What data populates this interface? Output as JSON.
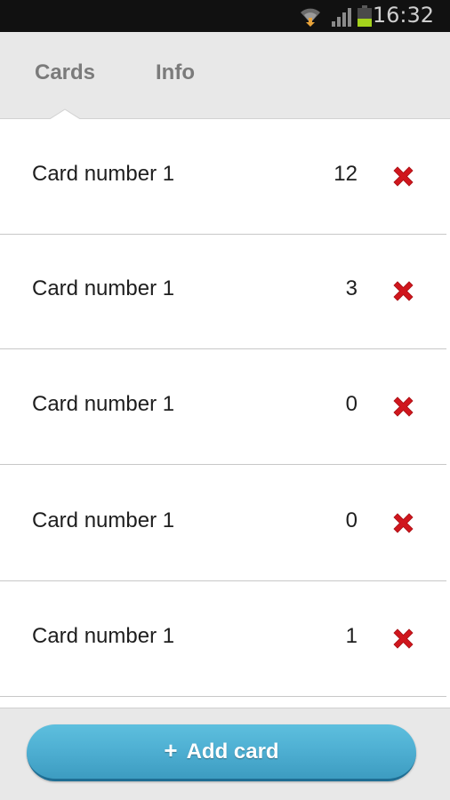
{
  "status_bar": {
    "time": "16:32",
    "icons": [
      "wifi-icon",
      "signal-icon",
      "battery-icon"
    ]
  },
  "tabs": [
    {
      "label": "Cards",
      "active": true
    },
    {
      "label": "Info",
      "active": false
    }
  ],
  "cards": [
    {
      "name": "Card number 1",
      "count": "12"
    },
    {
      "name": "Card number 1",
      "count": "3"
    },
    {
      "name": "Card number 1",
      "count": "0"
    },
    {
      "name": "Card number 1",
      "count": "0"
    },
    {
      "name": "Card number 1",
      "count": "1"
    }
  ],
  "footer": {
    "add_icon": "+",
    "add_label": "Add card"
  },
  "colors": {
    "delete": "#d0161d",
    "button": "#4fb0d3",
    "tabbar": "#e8e8e8"
  }
}
